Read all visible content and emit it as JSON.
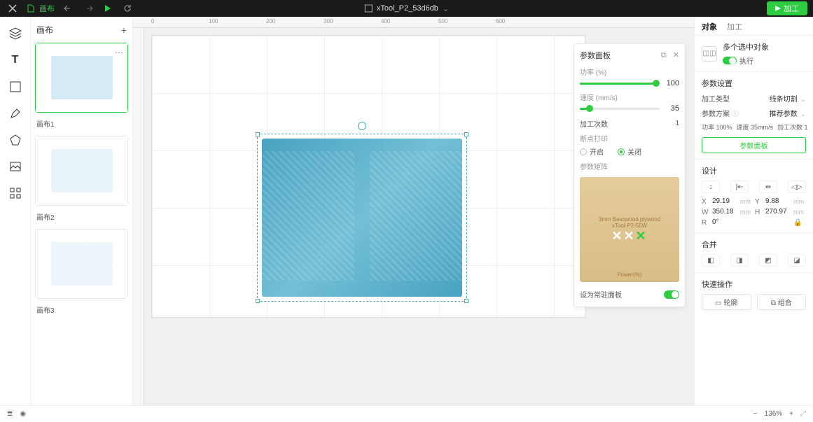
{
  "topbar": {
    "file_label": "画布",
    "project_name": "xTool_P2_53d6db",
    "process_label": "加工"
  },
  "canvas_panel": {
    "title": "画布",
    "thumbs": [
      "画布1",
      "画布2",
      "画布3"
    ]
  },
  "ruler_ticks": [
    "0",
    "100",
    "200",
    "300",
    "400",
    "500",
    "600"
  ],
  "param_panel": {
    "title": "参数面板",
    "power_label": "功率 (%)",
    "power_value": "100",
    "power_pct": 100,
    "speed_label": "速度 (mm/s)",
    "speed_value": "35",
    "speed_pct": 12,
    "passes_label": "加工次数",
    "passes_value": "1",
    "interval_label": "断点打印",
    "interval_on": "开启",
    "interval_off": "关闭",
    "matrix_label": "参数矩阵",
    "preview_line1": "3mm Basswood plywood",
    "preview_line2": "xTool-P2-55W",
    "preview_power": "Power(%)",
    "pin_label": "设为常驻面板"
  },
  "inspector": {
    "tab_object": "对象",
    "tab_process": "加工",
    "obj_title": "多个选中对象",
    "exec_label": "执行",
    "params_title": "参数设置",
    "proc_type_label": "加工类型",
    "proc_type_value": "线条切割",
    "scheme_label": "参数方案",
    "scheme_value": "推荐参数",
    "chip_power": "功率 100%",
    "chip_speed": "速度 35mm/s",
    "chip_passes": "加工次数 1",
    "param_panel_btn": "参数面板",
    "design_title": "设计",
    "x_label": "X",
    "x_value": "29.19",
    "x_unit": "mm",
    "y_label": "Y",
    "y_value": "9.88",
    "y_unit": "mm",
    "w_label": "W",
    "w_value": "350.18",
    "w_unit": "mm",
    "h_label": "H",
    "h_value": "270.97",
    "h_unit": "mm",
    "r_label": "R",
    "r_value": "0°",
    "merge_title": "合并",
    "quick_title": "快速操作",
    "quick_outline": "轮廓",
    "quick_group": "组合"
  },
  "statusbar": {
    "zoom": "136%"
  }
}
